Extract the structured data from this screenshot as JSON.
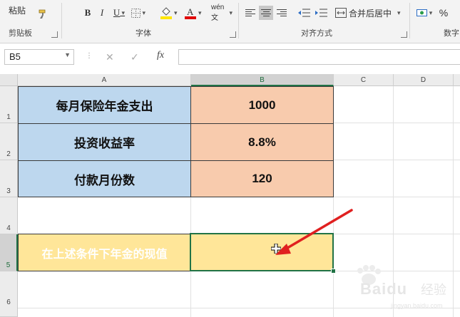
{
  "ribbon": {
    "paste_label": "粘贴",
    "clipboard_group": "剪贴板",
    "font_group": "字体",
    "align_group": "对齐方式",
    "number_group": "数字",
    "bold": "B",
    "italic": "I",
    "underline": "U",
    "phonetic": "wén文",
    "merge_label": "合并后居中",
    "percent": "%"
  },
  "formula_bar": {
    "name_box": "B5",
    "fx": "fx",
    "formula": ""
  },
  "columns": [
    "A",
    "B",
    "C",
    "D"
  ],
  "selected_column": "B",
  "rows": [
    "1",
    "2",
    "3",
    "4",
    "5",
    "6"
  ],
  "selected_row": "5",
  "cells": {
    "a1": "每月保险年金支出",
    "b1": "1000",
    "a2": "投资收益率",
    "b2": "8.8%",
    "a3": "付款月份数",
    "b3": "120",
    "a5": "在上述条件下年金的现值",
    "b5": ""
  },
  "colors": {
    "label_fill": "#bdd7ee",
    "value_fill": "#f8cbad",
    "highlight_fill": "#ffe699",
    "selection": "#217346",
    "annotation_arrow": "#e02020"
  },
  "watermark": {
    "brand": "Baidu",
    "brand_cn": "经验",
    "url": "jingyan.baidu.com"
  }
}
